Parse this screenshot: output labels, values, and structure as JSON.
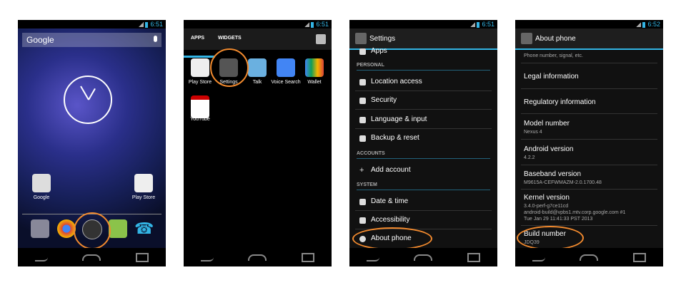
{
  "status": {
    "time1": "6:51",
    "time2": "6:51",
    "time3": "6:51",
    "time4": "6:52"
  },
  "home": {
    "search_label": "Google",
    "folder_label": "Google",
    "playstore_label": "Play Store"
  },
  "apps": {
    "tab_apps": "APPS",
    "tab_widgets": "WIDGETS",
    "items": [
      "Play Store",
      "Settings",
      "Talk",
      "Voice Search",
      "Wallet",
      "YouTube"
    ]
  },
  "settings": {
    "title": "Settings",
    "partial_top": "Apps",
    "section_personal": "PERSONAL",
    "personal": [
      "Location access",
      "Security",
      "Language & input",
      "Backup & reset"
    ],
    "section_accounts": "ACCOUNTS",
    "add_account": "Add account",
    "section_system": "SYSTEM",
    "system": [
      "Date & time",
      "Accessibility",
      "About phone"
    ]
  },
  "about": {
    "title": "About phone",
    "status_sub": "Phone number, signal, etc.",
    "legal": "Legal information",
    "regulatory": "Regulatory information",
    "model_label": "Model number",
    "model_value": "Nexus 4",
    "android_label": "Android version",
    "android_value": "4.2.2",
    "baseband_label": "Baseband version",
    "baseband_value": "M9615A-CEFWMAZM-2.0.1700.48",
    "kernel_label": "Kernel version",
    "kernel_l1": "3.4.0-perf-g7ce11cd",
    "kernel_l2": "android-build@vpbs1.mtv.corp.google.com #1",
    "kernel_l3": "Tue Jan 29 11:41:33 PST 2013",
    "build_label": "Build number",
    "build_value": "JDQ39"
  },
  "colors": {
    "accent": "#33b5e5",
    "highlight": "#f28a2e"
  }
}
